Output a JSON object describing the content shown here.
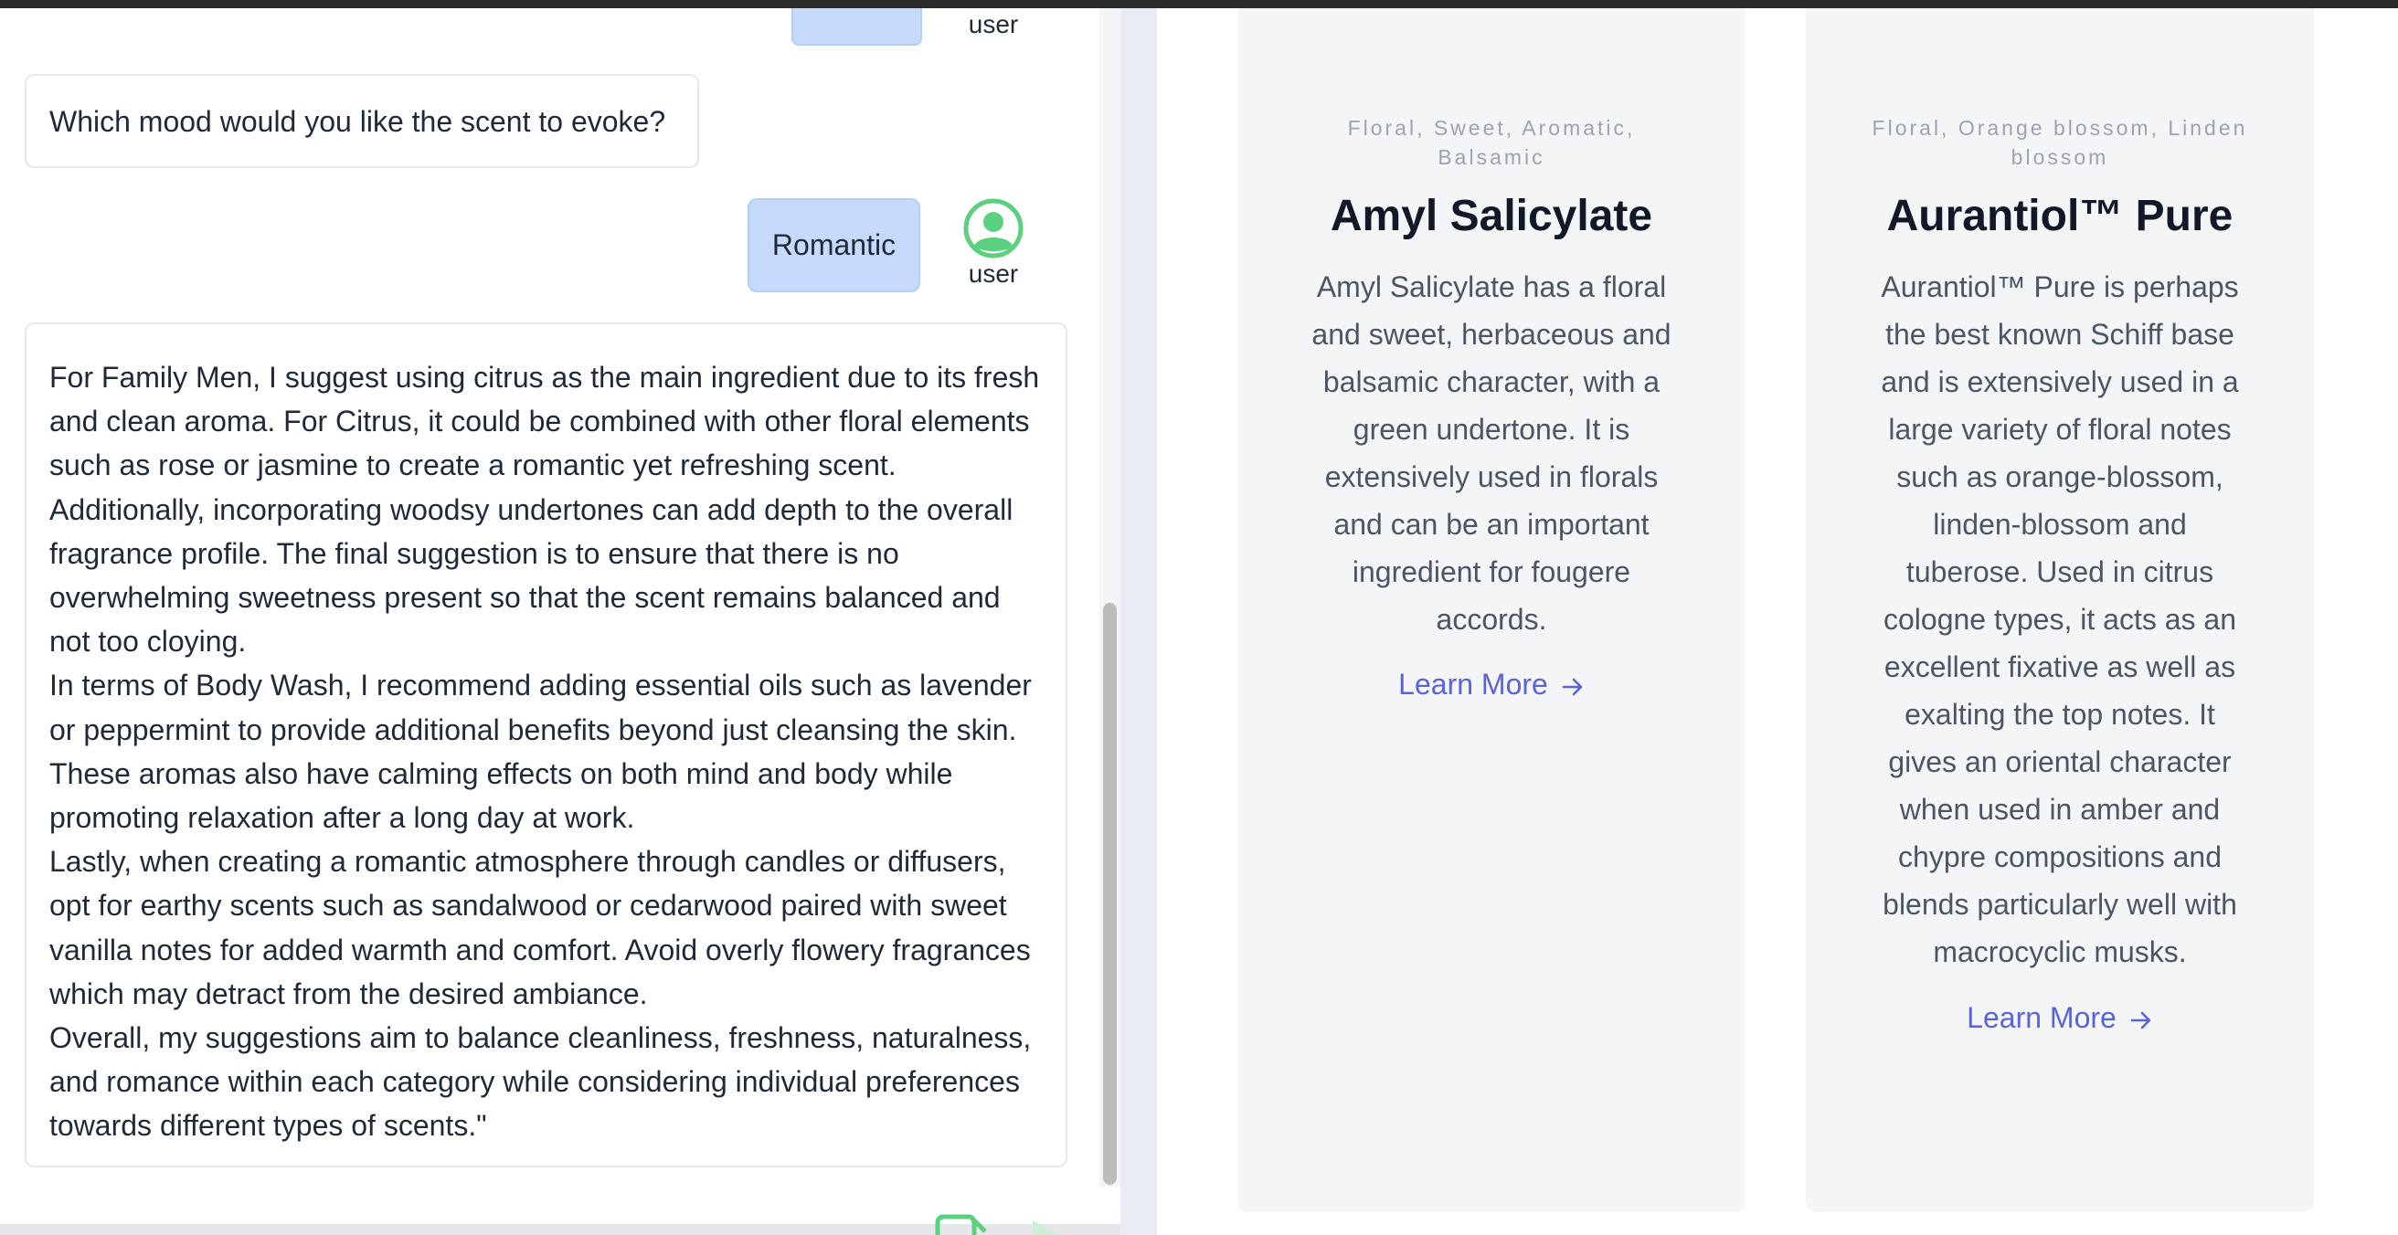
{
  "chat": {
    "user_label": "user",
    "question": "Which mood would you like the scent to evoke?",
    "user_answer": "Romantic",
    "bot_reply": [
      "For Family Men, I suggest using citrus as the main ingredient due to its fresh and clean aroma. For Citrus, it could be combined with other floral elements such as rose or jasmine to create a romantic yet refreshing scent. Additionally, incorporating woodsy undertones can add depth to the overall fragrance profile. The final suggestion is to ensure that there is no overwhelming sweetness present so that the scent remains balanced and not too cloying.",
      "In terms of Body Wash, I recommend adding essential oils such as lavender or peppermint to provide additional benefits beyond just cleansing the skin. These aromas also have calming effects on both mind and body while promoting relaxation after a long day at work.",
      "Lastly, when creating a romantic atmosphere through candles or diffusers, opt for earthy scents such as sandalwood or cedarwood paired with sweet vanilla notes for added warmth and comfort. Avoid overly flowery fragrances which may detract from the desired ambiance.",
      "Overall, my suggestions aim to balance cleanliness, freshness, naturalness, and romance within each category while considering individual preferences towards different types of scents.\""
    ]
  },
  "cards": [
    {
      "tags": "Floral, Sweet, Aromatic, Balsamic",
      "title": "Amyl Salicylate",
      "description": "Amyl Salicylate has a floral and sweet, herbaceous and balsamic character, with a green undertone. It is extensively used in florals and can be an important ingredient for fougere accords.",
      "link_label": "Learn More"
    },
    {
      "tags": "Floral, Orange blossom, Linden blossom",
      "title": "Aurantiol™ Pure",
      "description": "Aurantiol™ Pure is perhaps the best known Schiff base and is extensively used in a large variety of floral notes such as orange-blossom, linden-blossom and tuberose. Used in citrus cologne types, it acts as an excellent fixative as well as exalting the top notes. It gives an oriental character when used in amber and chypre compositions and blends particularly well with macrocyclic musks.",
      "link_label": "Learn More"
    }
  ],
  "colors": {
    "user_bubble": "#c5dafc",
    "avatar_green": "#5bd07f",
    "link": "#5a63d8",
    "card_bg": "#f4f5f7"
  },
  "icons": {
    "avatar": "user-avatar-icon",
    "link_arrow": "arrow-right-icon",
    "send": "send-icon"
  }
}
